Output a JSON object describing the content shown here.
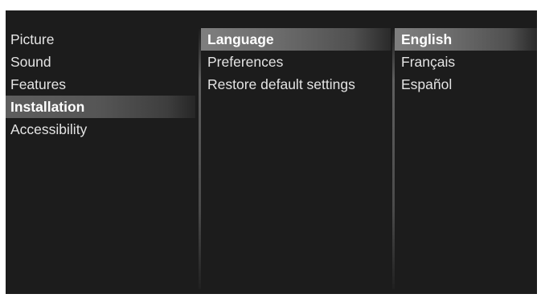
{
  "main_menu": {
    "items": [
      {
        "label": "Picture"
      },
      {
        "label": "Sound"
      },
      {
        "label": "Features"
      },
      {
        "label": "Installation"
      },
      {
        "label": "Accessibility"
      }
    ],
    "active_index": 3
  },
  "submenu": {
    "items": [
      {
        "label": "Language"
      },
      {
        "label": "Preferences"
      },
      {
        "label": "Restore default settings"
      }
    ],
    "selected_index": 0
  },
  "options_menu": {
    "items": [
      {
        "label": "English"
      },
      {
        "label": "Français"
      },
      {
        "label": "Español"
      }
    ],
    "selected_index": 0
  },
  "colors": {
    "background": "#1c1c1c",
    "highlight": "#7f7f7f",
    "text": "#e4e4e4"
  }
}
